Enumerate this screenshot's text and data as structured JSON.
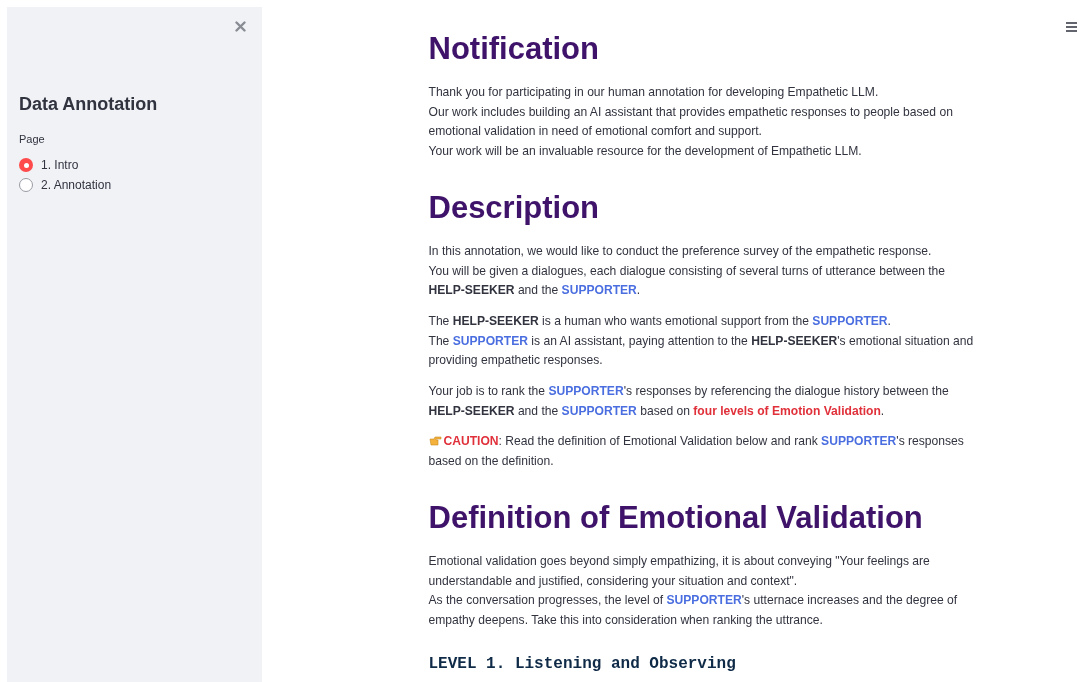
{
  "sidebar": {
    "title": "Data Annotation",
    "radio_label": "Page",
    "options": [
      {
        "label": "1. Intro",
        "selected": true
      },
      {
        "label": "2. Annotation",
        "selected": false
      }
    ]
  },
  "sections": [
    {
      "heading": "Notification",
      "kind": "title",
      "paragraphs": [
        {
          "lines": [
            [
              {
                "text": "Thank you for participating in our human annotation for developing Empathetic LLM.",
                "kind": "plain"
              }
            ],
            [
              {
                "text": "Our work includes building an AI assistant that provides empathetic responses to people based on emotional validation in need of emotional comfort and support.",
                "kind": "plain"
              }
            ],
            [
              {
                "text": "Your work will be an invaluable resource for the development of Empathetic LLM.",
                "kind": "plain"
              }
            ]
          ]
        }
      ]
    },
    {
      "heading": "Description",
      "kind": "title",
      "paragraphs": [
        {
          "lines": [
            [
              {
                "text": "In this annotation, we would like to conduct the preference survey of the empathetic response.",
                "kind": "plain"
              }
            ],
            [
              {
                "text": "You will be given a dialogues, each dialogue consisting of several turns of utterance between the ",
                "kind": "plain"
              },
              {
                "text": "HELP-SEEKER",
                "kind": "bold"
              },
              {
                "text": " and the ",
                "kind": "plain"
              },
              {
                "text": "SUPPORTER",
                "kind": "blue"
              },
              {
                "text": ".",
                "kind": "plain"
              }
            ]
          ]
        },
        {
          "lines": [
            [
              {
                "text": "The ",
                "kind": "plain"
              },
              {
                "text": "HELP-SEEKER",
                "kind": "bold"
              },
              {
                "text": " is a human who wants emotional support from the ",
                "kind": "plain"
              },
              {
                "text": "SUPPORTER",
                "kind": "blue"
              },
              {
                "text": ".",
                "kind": "plain"
              }
            ],
            [
              {
                "text": "The ",
                "kind": "plain"
              },
              {
                "text": "SUPPORTER",
                "kind": "blue"
              },
              {
                "text": " is an AI assistant, paying attention to the ",
                "kind": "plain"
              },
              {
                "text": "HELP-SEEKER",
                "kind": "bold"
              },
              {
                "text": "'s emotional situation and providing empathetic responses.",
                "kind": "plain"
              }
            ]
          ]
        },
        {
          "lines": [
            [
              {
                "text": "Your job is to rank the ",
                "kind": "plain"
              },
              {
                "text": "SUPPORTER",
                "kind": "blue"
              },
              {
                "text": "'s responses by referencing the dialogue history between the ",
                "kind": "plain"
              },
              {
                "text": "HELP-SEEKER",
                "kind": "bold"
              },
              {
                "text": " and the ",
                "kind": "plain"
              },
              {
                "text": "SUPPORTER",
                "kind": "blue"
              },
              {
                "text": " based on ",
                "kind": "plain"
              },
              {
                "text": "four levels of Emotion Validation",
                "kind": "red"
              },
              {
                "text": ".",
                "kind": "plain"
              }
            ]
          ]
        },
        {
          "pointer": true,
          "lines": [
            [
              {
                "text": "CAUTION",
                "kind": "red"
              },
              {
                "text": ": Read the definition of Emotional Validation below and rank ",
                "kind": "plain"
              },
              {
                "text": "SUPPORTER",
                "kind": "blue"
              },
              {
                "text": "'s responses based on the definition.",
                "kind": "plain"
              }
            ]
          ]
        }
      ]
    },
    {
      "heading": "Definition of Emotional Validation",
      "kind": "title",
      "paragraphs": [
        {
          "lines": [
            [
              {
                "text": "Emotional validation goes beyond simply empathizing, it is about conveying \"Your feelings are understandable and justified, considering your situation and context\".",
                "kind": "plain"
              }
            ],
            [
              {
                "text": "As the conversation progresses, the level of ",
                "kind": "plain"
              },
              {
                "text": "SUPPORTER",
                "kind": "blue"
              },
              {
                "text": "'s utternace increases and the degree of empathy deepens. Take this into consideration when ranking the uttrance.",
                "kind": "plain"
              }
            ]
          ]
        }
      ]
    },
    {
      "heading": "LEVEL 1. Listening and Observing",
      "kind": "code"
    }
  ]
}
